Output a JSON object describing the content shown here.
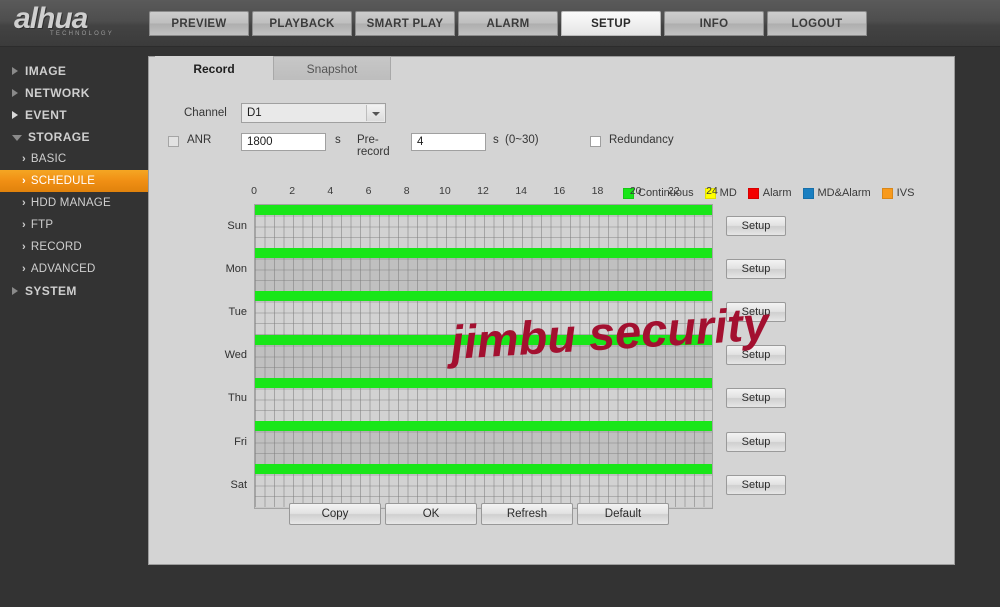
{
  "brand": {
    "name": "alhua",
    "tagline": "TECHNOLOGY"
  },
  "nav": {
    "tabs": [
      {
        "label": "PREVIEW",
        "active": false
      },
      {
        "label": "PLAYBACK",
        "active": false
      },
      {
        "label": "SMART PLAY",
        "active": false
      },
      {
        "label": "ALARM",
        "active": false
      },
      {
        "label": "SETUP",
        "active": true
      },
      {
        "label": "INFO",
        "active": false
      },
      {
        "label": "LOGOUT",
        "active": false
      }
    ]
  },
  "sidebar": {
    "groups": [
      {
        "label": "IMAGE",
        "expanded": false,
        "selected": false,
        "items": []
      },
      {
        "label": "NETWORK",
        "expanded": false,
        "selected": false,
        "items": []
      },
      {
        "label": "EVENT",
        "expanded": false,
        "selected": false,
        "items": []
      },
      {
        "label": "STORAGE",
        "expanded": true,
        "items": [
          {
            "label": "BASIC",
            "selected": false
          },
          {
            "label": "SCHEDULE",
            "selected": true
          },
          {
            "label": "HDD MANAGE",
            "selected": false
          },
          {
            "label": "FTP",
            "selected": false
          },
          {
            "label": "RECORD",
            "selected": false
          },
          {
            "label": "ADVANCED",
            "selected": false
          }
        ]
      },
      {
        "label": "SYSTEM",
        "expanded": false,
        "selected": false,
        "items": []
      }
    ]
  },
  "panel": {
    "subtabs": [
      {
        "label": "Record",
        "active": true
      },
      {
        "label": "Snapshot",
        "active": false
      }
    ],
    "form": {
      "channel_label": "Channel",
      "channel_value": "D1",
      "channel_options": [
        "D1"
      ],
      "anr_label": "ANR",
      "anr_checked": false,
      "anr_value": "1800",
      "anr_unit": "s",
      "prerecord_label": "Pre-record",
      "prerecord_value": "4",
      "prerecord_unit": "s",
      "prerecord_range": "(0~30)",
      "redundancy_label": "Redundancy",
      "redundancy_checked": false
    },
    "legend": [
      {
        "label": "Continuous",
        "color": "#19e619"
      },
      {
        "label": "MD",
        "color": "#ffff00"
      },
      {
        "label": "Alarm",
        "color": "#f40000"
      },
      {
        "label": "MD&Alarm",
        "color": "#1a7fc1"
      },
      {
        "label": "IVS",
        "color": "#f89a1c"
      }
    ],
    "schedule": {
      "hour_ticks": [
        "0",
        "2",
        "4",
        "6",
        "8",
        "10",
        "12",
        "14",
        "16",
        "18",
        "20",
        "22",
        "24"
      ],
      "setup_button_label": "Setup",
      "days": [
        {
          "label": "Sun",
          "bar_color": "#19e619",
          "bar_start_hour": 0,
          "bar_end_hour": 24
        },
        {
          "label": "Mon",
          "bar_color": "#19e619",
          "bar_start_hour": 0,
          "bar_end_hour": 24
        },
        {
          "label": "Tue",
          "bar_color": "#19e619",
          "bar_start_hour": 0,
          "bar_end_hour": 24
        },
        {
          "label": "Wed",
          "bar_color": "#19e619",
          "bar_start_hour": 0,
          "bar_end_hour": 24
        },
        {
          "label": "Thu",
          "bar_color": "#19e619",
          "bar_start_hour": 0,
          "bar_end_hour": 24
        },
        {
          "label": "Fri",
          "bar_color": "#19e619",
          "bar_start_hour": 0,
          "bar_end_hour": 24
        },
        {
          "label": "Sat",
          "bar_color": "#19e619",
          "bar_start_hour": 0,
          "bar_end_hour": 24
        }
      ]
    },
    "actions": [
      {
        "label": "Copy"
      },
      {
        "label": "OK"
      },
      {
        "label": "Refresh"
      },
      {
        "label": "Default"
      }
    ]
  },
  "watermark": {
    "text": "jimbu security",
    "color": "#a31030"
  }
}
